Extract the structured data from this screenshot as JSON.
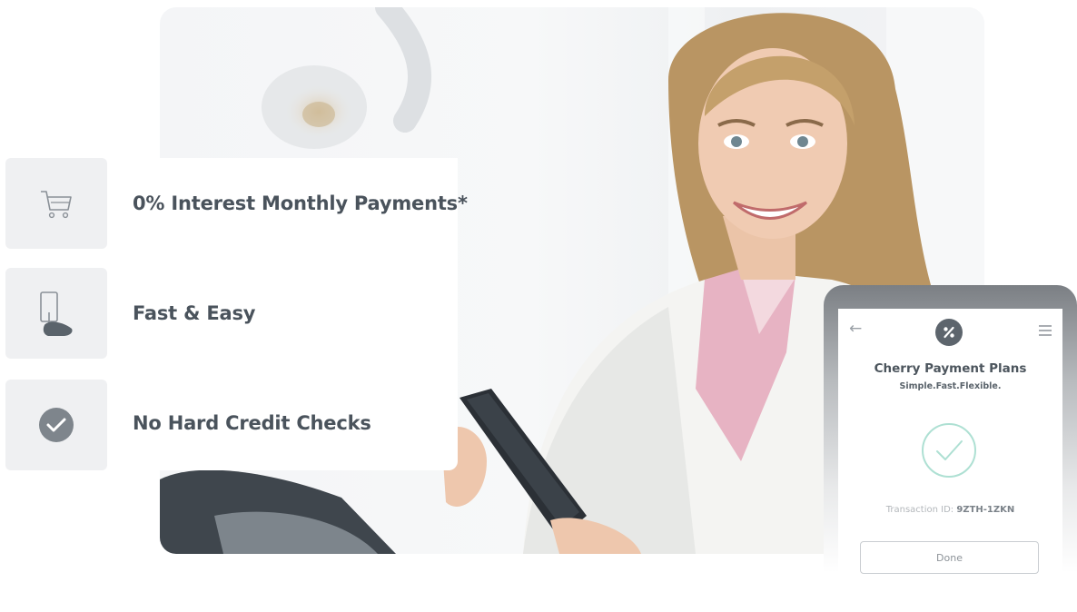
{
  "features": [
    {
      "icon": "shopping-cart-icon",
      "label": "0% Interest Monthly Payments*"
    },
    {
      "icon": "phone-tap-icon",
      "label": "Fast & Easy"
    },
    {
      "icon": "check-circle-icon",
      "label": "No Hard Credit Checks"
    }
  ],
  "phone": {
    "logo_icon": "percent-icon",
    "title": "Cherry Payment Plans",
    "subtitle": "Simple.Fast.Flexible.",
    "transaction_label": "Transaction ID: ",
    "transaction_id": "9ZTH-1ZKN",
    "done_label": "Done",
    "success_icon": "checkmark-circle-icon"
  },
  "colors": {
    "feature_text": "#4a535c",
    "icon_box": "#eff0f2",
    "success_teal": "#aee0d3",
    "logo": "#5d656d"
  }
}
